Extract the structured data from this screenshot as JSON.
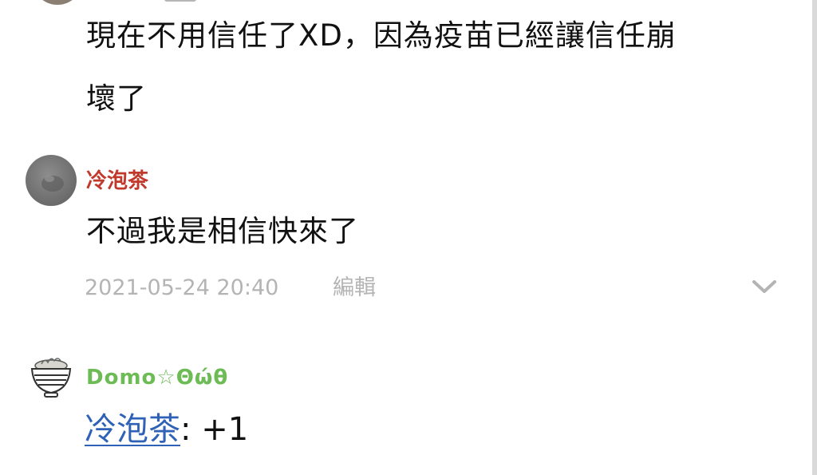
{
  "comments": [
    {
      "text_line1": "現在不用信任了XD，因為疫苗已經讓信任崩",
      "text_line2": "壞了"
    },
    {
      "username": "冷泡茶",
      "text": "不過我是相信快來了",
      "timestamp": "2021-05-24 20:40",
      "edit_label": "編輯"
    },
    {
      "username": "Domo☆Θώθ",
      "mention": "冷泡茶",
      "reply_rest": ": +1"
    }
  ],
  "colors": {
    "username_red": "#c0392b",
    "username_green": "#6dbb55",
    "mention_link": "#2f62b7",
    "meta_gray": "#b4b4b4"
  },
  "icons": {
    "expand": "chevron-down-icon"
  }
}
